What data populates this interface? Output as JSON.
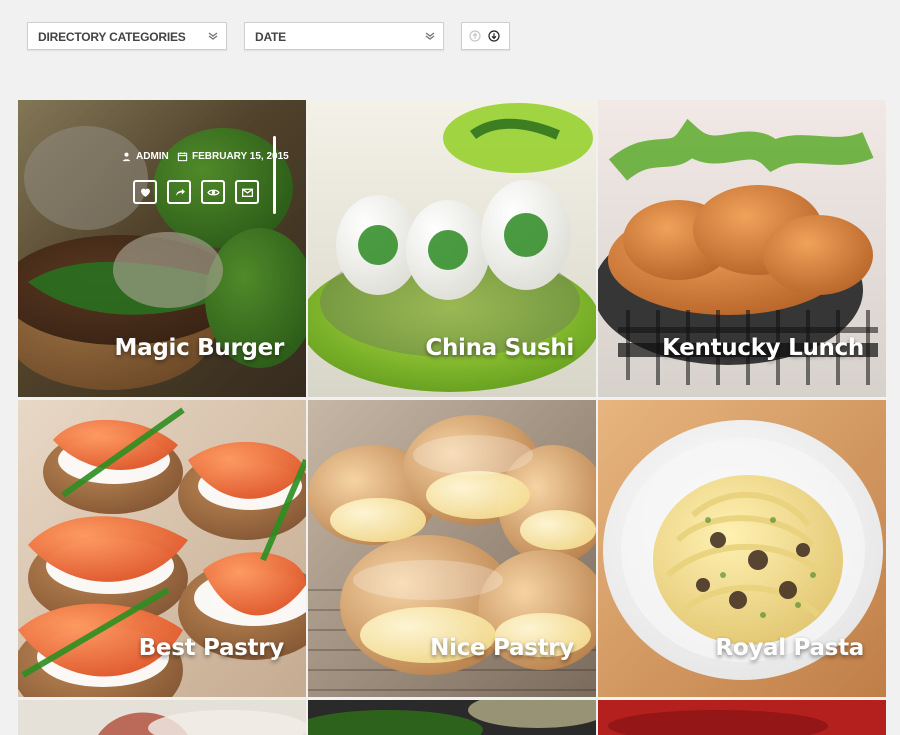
{
  "filters": {
    "categories": {
      "label": "Directory Categories"
    },
    "date": {
      "label": "Date"
    },
    "sort": {
      "asc": "arrow-up-circle-icon",
      "desc": "arrow-down-circle-icon"
    }
  },
  "tiles": [
    {
      "title": "Magic Burger",
      "meta": {
        "author": "ADMIN",
        "date": "FEBRUARY 15, 2015"
      },
      "colors": {
        "accent": "#ffffff"
      }
    },
    {
      "title": "China Sushi"
    },
    {
      "title": "Kentucky Lunch"
    },
    {
      "title": "Best Pastry"
    },
    {
      "title": "Nice Pastry"
    },
    {
      "title": "Royal Pasta"
    }
  ],
  "actions": [
    "heart-icon",
    "share-icon",
    "eye-icon",
    "envelope-icon"
  ]
}
